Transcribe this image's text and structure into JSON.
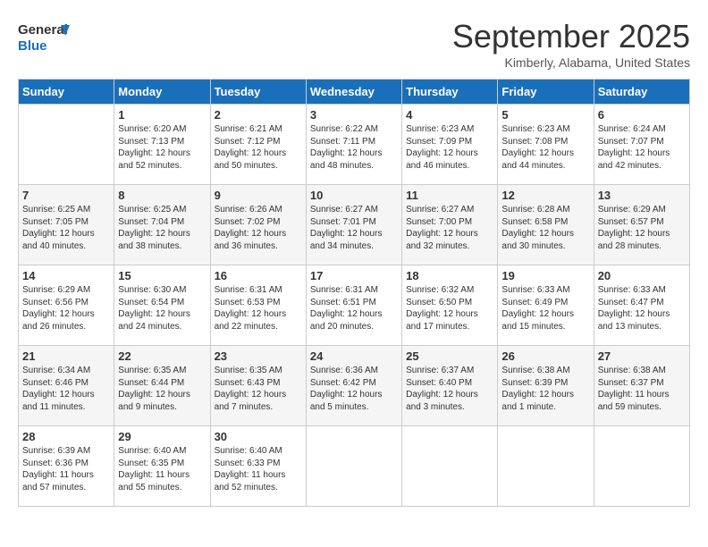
{
  "logo": {
    "line1": "General",
    "line2": "Blue"
  },
  "title": "September 2025",
  "location": "Kimberly, Alabama, United States",
  "days_of_week": [
    "Sunday",
    "Monday",
    "Tuesday",
    "Wednesday",
    "Thursday",
    "Friday",
    "Saturday"
  ],
  "weeks": [
    [
      {
        "day": "",
        "info": ""
      },
      {
        "day": "1",
        "info": "Sunrise: 6:20 AM\nSunset: 7:13 PM\nDaylight: 12 hours\nand 52 minutes."
      },
      {
        "day": "2",
        "info": "Sunrise: 6:21 AM\nSunset: 7:12 PM\nDaylight: 12 hours\nand 50 minutes."
      },
      {
        "day": "3",
        "info": "Sunrise: 6:22 AM\nSunset: 7:11 PM\nDaylight: 12 hours\nand 48 minutes."
      },
      {
        "day": "4",
        "info": "Sunrise: 6:23 AM\nSunset: 7:09 PM\nDaylight: 12 hours\nand 46 minutes."
      },
      {
        "day": "5",
        "info": "Sunrise: 6:23 AM\nSunset: 7:08 PM\nDaylight: 12 hours\nand 44 minutes."
      },
      {
        "day": "6",
        "info": "Sunrise: 6:24 AM\nSunset: 7:07 PM\nDaylight: 12 hours\nand 42 minutes."
      }
    ],
    [
      {
        "day": "7",
        "info": "Sunrise: 6:25 AM\nSunset: 7:05 PM\nDaylight: 12 hours\nand 40 minutes."
      },
      {
        "day": "8",
        "info": "Sunrise: 6:25 AM\nSunset: 7:04 PM\nDaylight: 12 hours\nand 38 minutes."
      },
      {
        "day": "9",
        "info": "Sunrise: 6:26 AM\nSunset: 7:02 PM\nDaylight: 12 hours\nand 36 minutes."
      },
      {
        "day": "10",
        "info": "Sunrise: 6:27 AM\nSunset: 7:01 PM\nDaylight: 12 hours\nand 34 minutes."
      },
      {
        "day": "11",
        "info": "Sunrise: 6:27 AM\nSunset: 7:00 PM\nDaylight: 12 hours\nand 32 minutes."
      },
      {
        "day": "12",
        "info": "Sunrise: 6:28 AM\nSunset: 6:58 PM\nDaylight: 12 hours\nand 30 minutes."
      },
      {
        "day": "13",
        "info": "Sunrise: 6:29 AM\nSunset: 6:57 PM\nDaylight: 12 hours\nand 28 minutes."
      }
    ],
    [
      {
        "day": "14",
        "info": "Sunrise: 6:29 AM\nSunset: 6:56 PM\nDaylight: 12 hours\nand 26 minutes."
      },
      {
        "day": "15",
        "info": "Sunrise: 6:30 AM\nSunset: 6:54 PM\nDaylight: 12 hours\nand 24 minutes."
      },
      {
        "day": "16",
        "info": "Sunrise: 6:31 AM\nSunset: 6:53 PM\nDaylight: 12 hours\nand 22 minutes."
      },
      {
        "day": "17",
        "info": "Sunrise: 6:31 AM\nSunset: 6:51 PM\nDaylight: 12 hours\nand 20 minutes."
      },
      {
        "day": "18",
        "info": "Sunrise: 6:32 AM\nSunset: 6:50 PM\nDaylight: 12 hours\nand 17 minutes."
      },
      {
        "day": "19",
        "info": "Sunrise: 6:33 AM\nSunset: 6:49 PM\nDaylight: 12 hours\nand 15 minutes."
      },
      {
        "day": "20",
        "info": "Sunrise: 6:33 AM\nSunset: 6:47 PM\nDaylight: 12 hours\nand 13 minutes."
      }
    ],
    [
      {
        "day": "21",
        "info": "Sunrise: 6:34 AM\nSunset: 6:46 PM\nDaylight: 12 hours\nand 11 minutes."
      },
      {
        "day": "22",
        "info": "Sunrise: 6:35 AM\nSunset: 6:44 PM\nDaylight: 12 hours\nand 9 minutes."
      },
      {
        "day": "23",
        "info": "Sunrise: 6:35 AM\nSunset: 6:43 PM\nDaylight: 12 hours\nand 7 minutes."
      },
      {
        "day": "24",
        "info": "Sunrise: 6:36 AM\nSunset: 6:42 PM\nDaylight: 12 hours\nand 5 minutes."
      },
      {
        "day": "25",
        "info": "Sunrise: 6:37 AM\nSunset: 6:40 PM\nDaylight: 12 hours\nand 3 minutes."
      },
      {
        "day": "26",
        "info": "Sunrise: 6:38 AM\nSunset: 6:39 PM\nDaylight: 12 hours\nand 1 minute."
      },
      {
        "day": "27",
        "info": "Sunrise: 6:38 AM\nSunset: 6:37 PM\nDaylight: 11 hours\nand 59 minutes."
      }
    ],
    [
      {
        "day": "28",
        "info": "Sunrise: 6:39 AM\nSunset: 6:36 PM\nDaylight: 11 hours\nand 57 minutes."
      },
      {
        "day": "29",
        "info": "Sunrise: 6:40 AM\nSunset: 6:35 PM\nDaylight: 11 hours\nand 55 minutes."
      },
      {
        "day": "30",
        "info": "Sunrise: 6:40 AM\nSunset: 6:33 PM\nDaylight: 11 hours\nand 52 minutes."
      },
      {
        "day": "",
        "info": ""
      },
      {
        "day": "",
        "info": ""
      },
      {
        "day": "",
        "info": ""
      },
      {
        "day": "",
        "info": ""
      }
    ]
  ]
}
